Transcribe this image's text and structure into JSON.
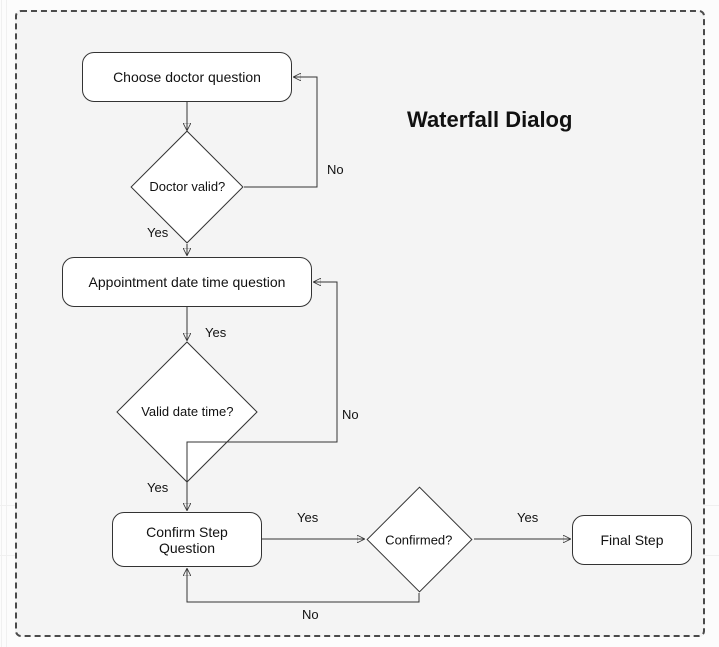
{
  "title": "Waterfall Dialog",
  "nodes": {
    "n1": {
      "type": "process",
      "label": "Choose doctor question"
    },
    "n2": {
      "type": "decision",
      "label": "Doctor valid?"
    },
    "n3": {
      "type": "process",
      "label": "Appointment date time question"
    },
    "n4": {
      "type": "decision",
      "label": "Valid date time?"
    },
    "n5": {
      "type": "process",
      "label": "Confirm Step\nQuestion"
    },
    "n6": {
      "type": "decision",
      "label": "Confirmed?"
    },
    "n7": {
      "type": "process",
      "label": "Final Step"
    }
  },
  "edges": {
    "e_n2_no": "No",
    "e_n2_yes": "Yes",
    "e_n3_down": "Yes",
    "e_n4_no": "No",
    "e_n4_yes": "Yes",
    "e_n5_n6": "Yes",
    "e_n6_yes": "Yes",
    "e_n6_no": "No"
  },
  "chart_data": {
    "type": "flowchart",
    "title": "Waterfall Dialog",
    "nodes": [
      {
        "id": "n1",
        "kind": "process",
        "label": "Choose doctor question"
      },
      {
        "id": "n2",
        "kind": "decision",
        "label": "Doctor valid?"
      },
      {
        "id": "n3",
        "kind": "process",
        "label": "Appointment date time question"
      },
      {
        "id": "n4",
        "kind": "decision",
        "label": "Valid date time?"
      },
      {
        "id": "n5",
        "kind": "process",
        "label": "Confirm Step Question"
      },
      {
        "id": "n6",
        "kind": "decision",
        "label": "Confirmed?"
      },
      {
        "id": "n7",
        "kind": "process",
        "label": "Final Step"
      }
    ],
    "edges": [
      {
        "from": "n1",
        "to": "n2",
        "label": ""
      },
      {
        "from": "n2",
        "to": "n1",
        "label": "No"
      },
      {
        "from": "n2",
        "to": "n3",
        "label": "Yes"
      },
      {
        "from": "n3",
        "to": "n4",
        "label": "Yes"
      },
      {
        "from": "n4",
        "to": "n3",
        "label": "No"
      },
      {
        "from": "n4",
        "to": "n5",
        "label": "Yes"
      },
      {
        "from": "n5",
        "to": "n6",
        "label": "Yes"
      },
      {
        "from": "n6",
        "to": "n7",
        "label": "Yes"
      },
      {
        "from": "n6",
        "to": "n5",
        "label": "No"
      }
    ]
  }
}
